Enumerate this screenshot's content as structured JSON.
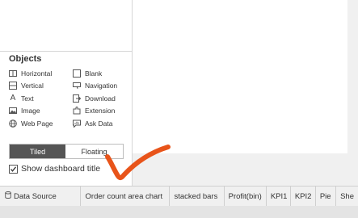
{
  "objects": {
    "title": "Objects",
    "items": [
      {
        "label": "Horizontal",
        "icon": "horizontal-container-icon"
      },
      {
        "label": "Blank",
        "icon": "blank-icon"
      },
      {
        "label": "Vertical",
        "icon": "vertical-container-icon"
      },
      {
        "label": "Navigation",
        "icon": "navigation-icon"
      },
      {
        "label": "Text",
        "icon": "text-icon"
      },
      {
        "label": "Download",
        "icon": "download-icon"
      },
      {
        "label": "Image",
        "icon": "image-icon"
      },
      {
        "label": "Extension",
        "icon": "extension-icon"
      },
      {
        "label": "Web Page",
        "icon": "globe-icon"
      },
      {
        "label": "Ask Data",
        "icon": "ask-data-icon"
      }
    ]
  },
  "layout_toggle": {
    "tiled": "Tiled",
    "floating": "Floating",
    "selected": "Tiled"
  },
  "show_title": {
    "label": "Show dashboard title",
    "checked": true
  },
  "tabs": [
    {
      "label": "Data Source",
      "icon": "database-icon"
    },
    {
      "label": "Order count area chart"
    },
    {
      "label": "stacked bars"
    },
    {
      "label": "Profit(bin)"
    },
    {
      "label": "KPI1"
    },
    {
      "label": "KPI2"
    },
    {
      "label": "Pie"
    },
    {
      "label": "She"
    }
  ],
  "colors": {
    "toggle_selected_bg": "#555555",
    "annotation_stroke": "#e8541a",
    "panel_bg": "#f0f0f0"
  }
}
